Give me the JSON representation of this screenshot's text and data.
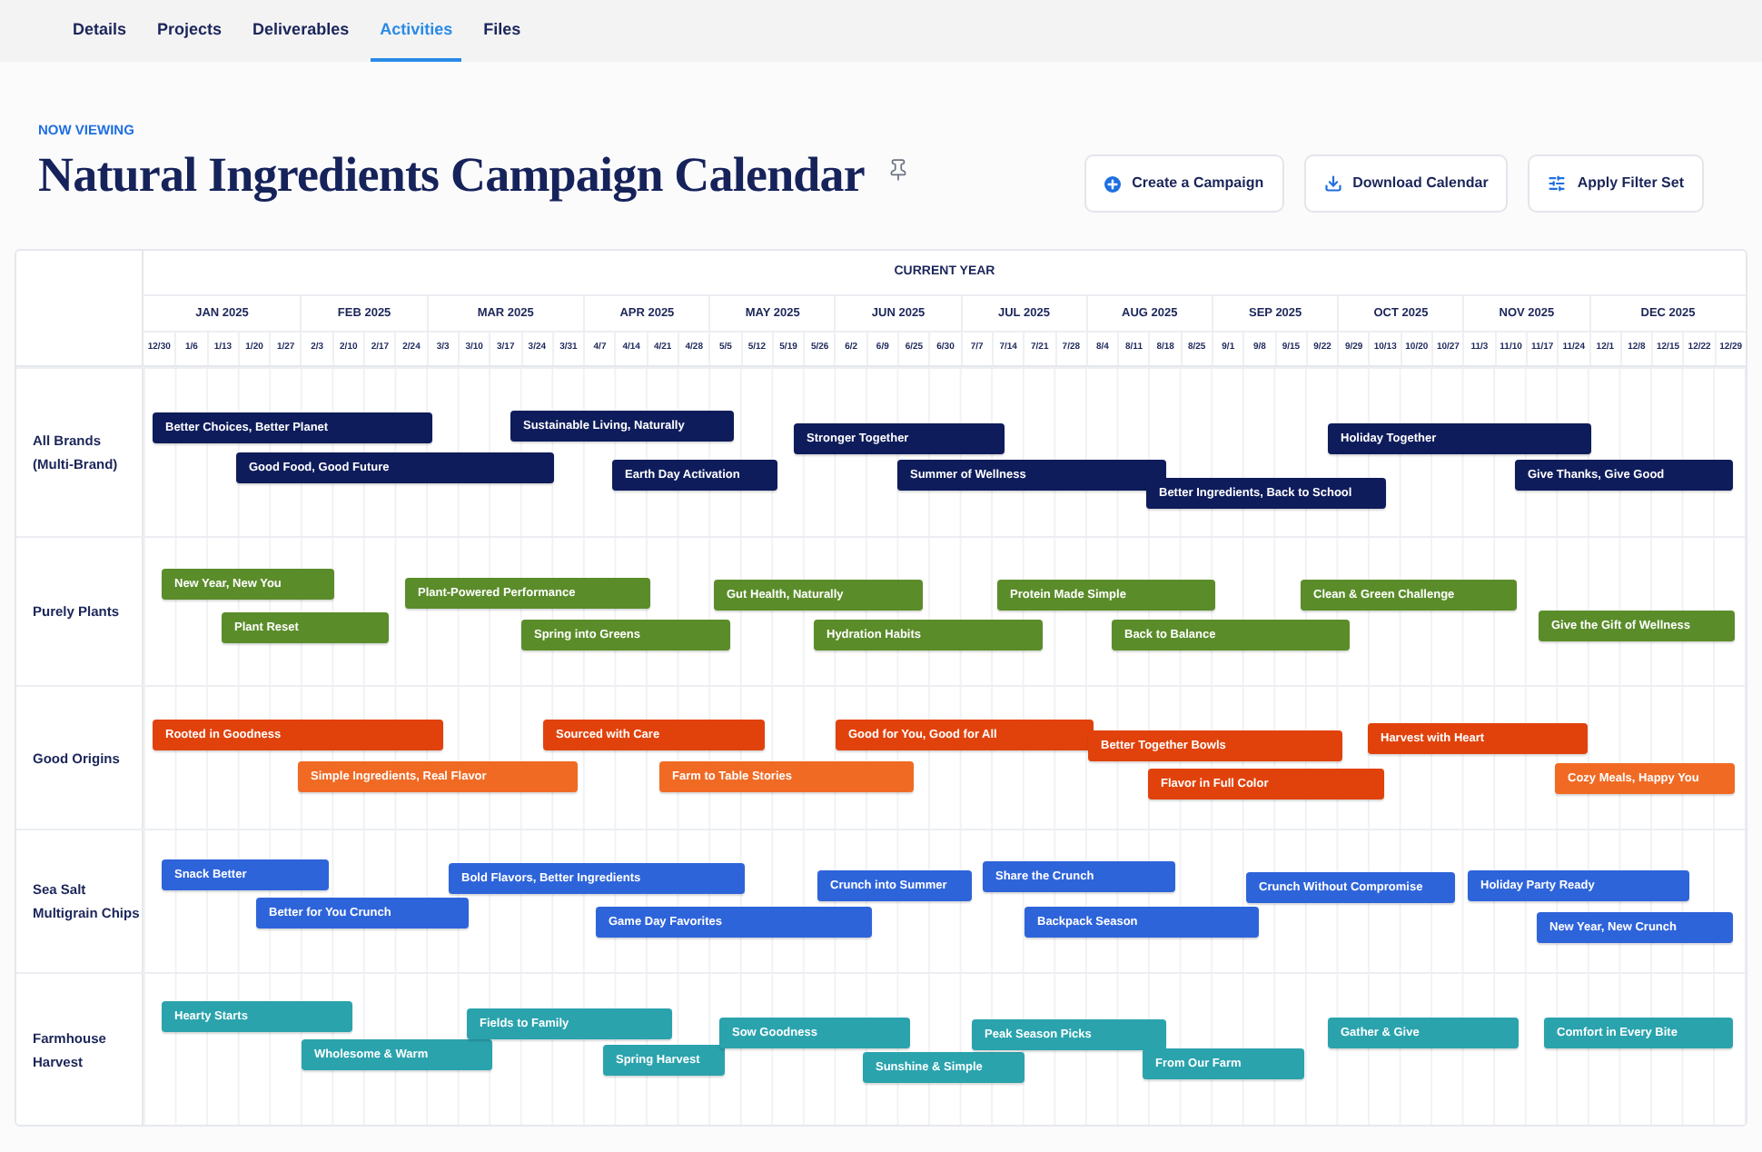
{
  "tabs": [
    {
      "label": "Details",
      "selected": false
    },
    {
      "label": "Projects",
      "selected": false
    },
    {
      "label": "Deliverables",
      "selected": false
    },
    {
      "label": "Activities",
      "selected": true
    },
    {
      "label": "Files",
      "selected": false
    }
  ],
  "header": {
    "eyebrow": "NOW VIEWING",
    "title": "Natural Ingredients Campaign Calendar",
    "actions": [
      "Create a Campaign",
      "Download Calendar",
      "Apply Filter Set"
    ]
  },
  "calendar": {
    "period_label": "CURRENT YEAR",
    "months": [
      {
        "label": "JAN 2025",
        "weeks": [
          "12/30",
          "1/6",
          "1/13",
          "1/20",
          "1/27"
        ]
      },
      {
        "label": "FEB 2025",
        "weeks": [
          "2/3",
          "2/10",
          "2/17",
          "2/24"
        ]
      },
      {
        "label": "MAR 2025",
        "weeks": [
          "3/3",
          "3/10",
          "3/17",
          "3/24",
          "3/31"
        ]
      },
      {
        "label": "APR 2025",
        "weeks": [
          "4/7",
          "4/14",
          "4/21",
          "4/28"
        ]
      },
      {
        "label": "MAY 2025",
        "weeks": [
          "5/5",
          "5/12",
          "5/19",
          "5/26"
        ]
      },
      {
        "label": "JUN 2025",
        "weeks": [
          "6/2",
          "6/9",
          "6/25",
          "6/30"
        ]
      },
      {
        "label": "JUL 2025",
        "weeks": [
          "7/7",
          "7/14",
          "7/21",
          "7/28"
        ]
      },
      {
        "label": "AUG 2025",
        "weeks": [
          "8/4",
          "8/11",
          "8/18",
          "8/25"
        ]
      },
      {
        "label": "SEP 2025",
        "weeks": [
          "9/1",
          "9/8",
          "9/15",
          "9/22"
        ]
      },
      {
        "label": "OCT 2025",
        "weeks": [
          "9/29",
          "10/13",
          "10/20",
          "10/27"
        ]
      },
      {
        "label": "NOV 2025",
        "weeks": [
          "11/3",
          "11/10",
          "11/17",
          "11/24"
        ]
      },
      {
        "label": "DEC 2025",
        "weeks": [
          "12/1",
          "12/8",
          "12/15",
          "12/22",
          "12/29"
        ]
      }
    ],
    "rows": [
      {
        "brand": "All Brands (Multi-Brand)",
        "campaigns": [
          {
            "name": "Better Choices, Better Planet",
            "color": "#0e1c5b"
          },
          {
            "name": "Good Food, Good Future",
            "color": "#0e1c5b"
          },
          {
            "name": "Sustainable Living, Naturally",
            "color": "#0e1c5b"
          },
          {
            "name": "Earth Day Activation",
            "color": "#0e1c5b"
          },
          {
            "name": "Stronger Together",
            "color": "#0e1c5b"
          },
          {
            "name": "Summer of Wellness",
            "color": "#0e1c5b"
          },
          {
            "name": "Better Ingredients, Back to School",
            "color": "#0e1c5b"
          },
          {
            "name": "Holiday Together",
            "color": "#0e1c5b"
          },
          {
            "name": "Give Thanks, Give Good",
            "color": "#0e1c5b"
          }
        ]
      },
      {
        "brand": "Purely Plants",
        "campaigns": [
          {
            "name": "New Year, New You",
            "color": "#5b8c2a"
          },
          {
            "name": "Plant Reset",
            "color": "#5b8c2a"
          },
          {
            "name": "Plant-Powered Performance",
            "color": "#5b8c2a"
          },
          {
            "name": "Spring into Greens",
            "color": "#5b8c2a"
          },
          {
            "name": "Gut Health, Naturally",
            "color": "#5b8c2a"
          },
          {
            "name": "Hydration Habits",
            "color": "#5b8c2a"
          },
          {
            "name": "Protein Made Simple",
            "color": "#5b8c2a"
          },
          {
            "name": "Back to Balance",
            "color": "#5b8c2a"
          },
          {
            "name": "Clean & Green Challenge",
            "color": "#5b8c2a"
          },
          {
            "name": "Give the Gift of Wellness",
            "color": "#5b8c2a"
          }
        ]
      },
      {
        "brand": "Good Origins",
        "campaigns": [
          {
            "name": "Rooted in Goodness",
            "color": "#e1420c"
          },
          {
            "name": "Simple Ingredients, Real Flavor",
            "color": "#f06a24"
          },
          {
            "name": "Sourced with Care",
            "color": "#e1420c"
          },
          {
            "name": "Farm to Table Stories",
            "color": "#f06a24"
          },
          {
            "name": "Good for You, Good for All",
            "color": "#e1420c"
          },
          {
            "name": "Better Together Bowls",
            "color": "#e1420c"
          },
          {
            "name": "Flavor in Full Color",
            "color": "#e1420c"
          },
          {
            "name": "Harvest with Heart",
            "color": "#e1420c"
          },
          {
            "name": "Cozy Meals, Happy You",
            "color": "#f06a24"
          }
        ]
      },
      {
        "brand": "Sea Salt Multigrain Chips",
        "campaigns": [
          {
            "name": "Snack Better",
            "color": "#2e64da"
          },
          {
            "name": "Better for You Crunch",
            "color": "#2e64da"
          },
          {
            "name": "Bold Flavors, Better Ingredients",
            "color": "#2e64da"
          },
          {
            "name": "Game Day Favorites",
            "color": "#2e64da"
          },
          {
            "name": "Crunch into Summer",
            "color": "#2e64da"
          },
          {
            "name": "Share the Crunch",
            "color": "#2e64da"
          },
          {
            "name": "Backpack Season",
            "color": "#2e64da"
          },
          {
            "name": "Crunch Without Compromise",
            "color": "#2e64da"
          },
          {
            "name": "Holiday Party Ready",
            "color": "#2e64da"
          },
          {
            "name": "New Year, New Crunch",
            "color": "#2e64da"
          }
        ]
      },
      {
        "brand": "Farmhouse Harvest",
        "campaigns": [
          {
            "name": "Hearty Starts",
            "color": "#2aa3ad"
          },
          {
            "name": "Wholesome & Warm",
            "color": "#2aa3ad"
          },
          {
            "name": "Fields to Family",
            "color": "#2aa3ad"
          },
          {
            "name": "Spring Harvest",
            "color": "#2aa3ad"
          },
          {
            "name": "Sow Goodness",
            "color": "#2aa3ad"
          },
          {
            "name": "Sunshine & Simple",
            "color": "#2aa3ad"
          },
          {
            "name": "Peak Season Picks",
            "color": "#2aa3ad"
          },
          {
            "name": "From Our Farm",
            "color": "#2aa3ad"
          },
          {
            "name": "Gather & Give",
            "color": "#2aa3ad"
          },
          {
            "name": "Comfort in Every Bite",
            "color": "#2aa3ad"
          }
        ]
      }
    ]
  }
}
